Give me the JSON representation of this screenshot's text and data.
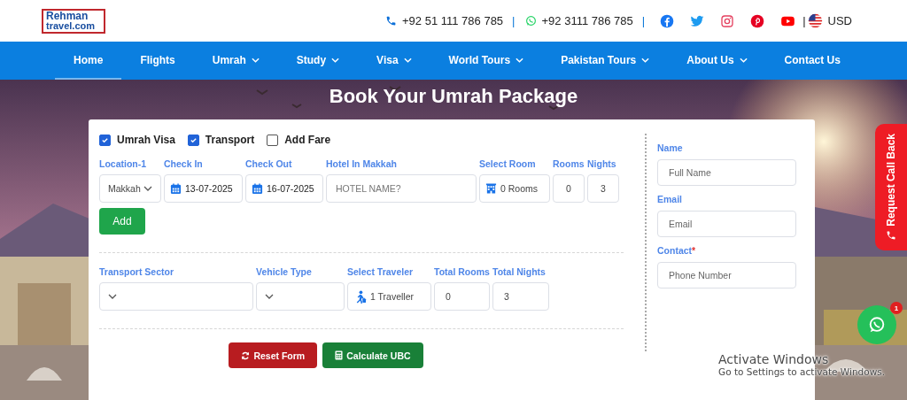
{
  "header": {
    "logo": {
      "top": "Rehman",
      "bottom": "travel.com"
    },
    "phone": "+92 51 111 786 785",
    "whatsapp": "+92 3111 786 785",
    "separator": "|",
    "currency": "USD"
  },
  "nav": [
    {
      "label": "Home",
      "selected": true,
      "dropdown": false
    },
    {
      "label": "Flights",
      "selected": false,
      "dropdown": false
    },
    {
      "label": "Umrah",
      "selected": false,
      "dropdown": true
    },
    {
      "label": "Study",
      "selected": false,
      "dropdown": true
    },
    {
      "label": "Visa",
      "selected": false,
      "dropdown": true
    },
    {
      "label": "World Tours",
      "selected": false,
      "dropdown": true
    },
    {
      "label": "Pakistan Tours",
      "selected": false,
      "dropdown": true
    },
    {
      "label": "About Us",
      "selected": false,
      "dropdown": true
    },
    {
      "label": "Contact Us",
      "selected": false,
      "dropdown": false
    }
  ],
  "hero": {
    "kind": "picture",
    "title": "Book Your Umrah Package"
  },
  "form": {
    "options": [
      {
        "label": "Umrah Visa",
        "checked": true
      },
      {
        "label": "Transport",
        "checked": true
      },
      {
        "label": "Add Fare",
        "checked": false
      }
    ],
    "hotel_fields": [
      {
        "label": "Location-1",
        "kind": "select",
        "value": "Makkah"
      },
      {
        "label": "Check In",
        "kind": "date",
        "value": "13-07-2025"
      },
      {
        "label": "Check Out",
        "kind": "date",
        "value": "16-07-2025"
      },
      {
        "label": "Hotel In Makkah",
        "kind": "text",
        "placeholder": "HOTEL NAME?"
      },
      {
        "label": "Select Room",
        "kind": "rooms",
        "value": "0 Rooms"
      },
      {
        "label": "Rooms",
        "kind": "number",
        "value": "0"
      },
      {
        "label": "Nights",
        "kind": "number",
        "value": "3"
      }
    ],
    "add_button": "Add",
    "transport_fields": [
      {
        "label": "Transport Sector",
        "kind": "select"
      },
      {
        "label": "Vehicle Type",
        "kind": "select"
      },
      {
        "label": "Select Traveler",
        "kind": "traveler",
        "value": "1 Traveller"
      },
      {
        "label": "Total Rooms",
        "kind": "plain",
        "value": "0"
      },
      {
        "label": "Total Nights",
        "kind": "plain",
        "value": "3"
      }
    ],
    "buttons": [
      {
        "label": "Reset Form",
        "kind": "reset"
      },
      {
        "label": "Calculate UBC",
        "kind": "calculate"
      }
    ],
    "contact": [
      {
        "label": "Name",
        "placeholder": "Full Name"
      },
      {
        "label": "Email",
        "placeholder": "Email"
      },
      {
        "label": "Contact",
        "required_mark": "*",
        "placeholder": "Phone Number"
      }
    ]
  },
  "call_back": "Request Call Back",
  "chat": {
    "badge": "1"
  },
  "os_overlay": {
    "title": "Activate Windows",
    "subtitle": "Go to Settings to activate Windows."
  }
}
